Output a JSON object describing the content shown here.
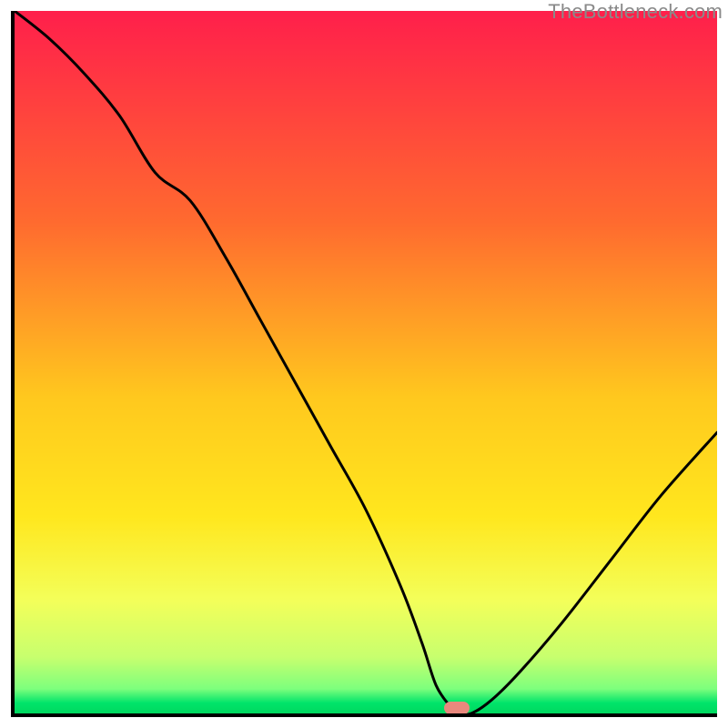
{
  "watermark": "TheBottleneck.com",
  "colors": {
    "top": "#ff1f4b",
    "mid_upper": "#ff8a2a",
    "mid": "#ffd400",
    "mid_lower": "#f6ff3a",
    "lower_band": "#d9ff63",
    "green": "#00e46a",
    "curve": "#000000",
    "axis": "#000000",
    "marker": "#e9887d"
  },
  "chart_data": {
    "type": "line",
    "title": "",
    "xlabel": "",
    "ylabel": "",
    "xlim": [
      0,
      100
    ],
    "ylim": [
      0,
      100
    ],
    "grid": false,
    "legend": false,
    "note": "Bottleneck-style curve: y≈100 at far left, dips to ~0 near x≈63, rises toward ~40 at x=100. Values estimated from pixels; no axis tick labels are shown.",
    "series": [
      {
        "name": "bottleneck-curve",
        "x": [
          0,
          5,
          10,
          15,
          20,
          25,
          30,
          35,
          40,
          45,
          50,
          55,
          58,
          60,
          62,
          63,
          65,
          68,
          72,
          78,
          85,
          92,
          100
        ],
        "y": [
          100,
          96,
          91,
          85,
          77,
          73,
          65,
          56,
          47,
          38,
          29,
          18,
          10,
          4,
          1,
          0,
          0,
          2,
          6,
          13,
          22,
          31,
          40
        ]
      }
    ],
    "marker": {
      "x": 63,
      "y": 0.8
    },
    "gradient_stops": [
      {
        "pos": 0.0,
        "color": "#ff1f4b"
      },
      {
        "pos": 0.3,
        "color": "#ff6a2f"
      },
      {
        "pos": 0.55,
        "color": "#ffc81e"
      },
      {
        "pos": 0.72,
        "color": "#ffe71e"
      },
      {
        "pos": 0.84,
        "color": "#f3ff5a"
      },
      {
        "pos": 0.92,
        "color": "#c7ff6e"
      },
      {
        "pos": 0.965,
        "color": "#7dff7d"
      },
      {
        "pos": 0.985,
        "color": "#00e46a"
      },
      {
        "pos": 1.0,
        "color": "#00d85f"
      }
    ]
  }
}
